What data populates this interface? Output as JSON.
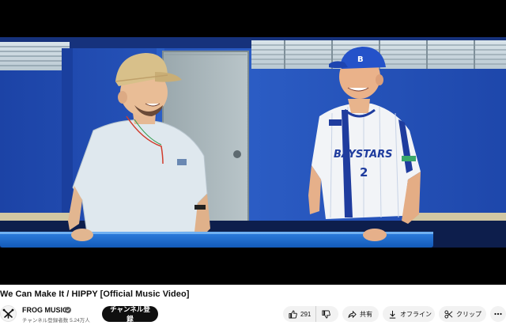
{
  "video": {
    "title": "We Can Make It / HIPPY [Official Music Video]",
    "jersey_text": "BAYSTARS",
    "jersey_number": "2",
    "cap_letter": "B"
  },
  "channel": {
    "name": "FROG MUSIC",
    "subscribers": "チャンネル登録者数 5.24万人",
    "subscribe_label": "チャンネル登録"
  },
  "actions": {
    "like_count": "291",
    "share_label": "共有",
    "offline_label": "オフライン",
    "clip_label": "クリップ"
  },
  "icons": {
    "like": "thumbs-up-icon",
    "dislike": "thumbs-down-icon",
    "share": "share-arrow-icon",
    "offline": "download-icon",
    "clip": "scissors-icon",
    "more": "more-dots-icon",
    "verified": "verified-check-icon"
  },
  "colors": {
    "subscribe_bg": "#0f0f0f",
    "pill_bg": "#f2f2f2",
    "stadium_blue": "#2a55b8",
    "baystars_blue": "#1f3c9e"
  }
}
